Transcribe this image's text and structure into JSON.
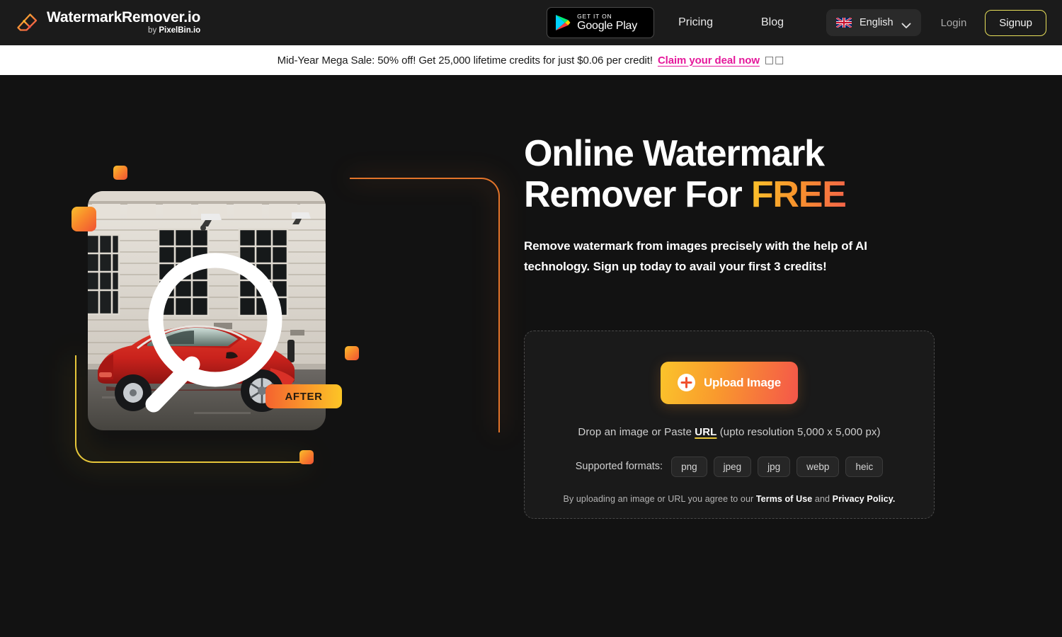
{
  "header": {
    "brand": {
      "name": "WatermarkRemover.io",
      "by_prefix": "by ",
      "by_name": "PixelBin.io"
    },
    "google_play": {
      "small": "GET IT ON",
      "big": "Google Play"
    },
    "nav": {
      "pricing": "Pricing",
      "blog": "Blog"
    },
    "language": {
      "label": "English",
      "flag": "uk-flag-icon"
    },
    "auth": {
      "login": "Login",
      "signup": "Signup"
    }
  },
  "promo": {
    "text": "Mid-Year Mega Sale: 50% off! Get 25,000 lifetime credits for just $0.06 per credit!",
    "cta": "Claim your deal now",
    "emoji": "□□"
  },
  "hero": {
    "headline_part1": "Online Watermark",
    "headline_part2": "Remover For ",
    "headline_highlight": "FREE",
    "subheadline": "Remove watermark from images precisely with the help of AI technology. Sign up today to avail your first 3 credits!",
    "image_badge": "AFTER"
  },
  "upload": {
    "button_label": "Upload Image",
    "drop_prefix": "Drop an image or Paste ",
    "drop_link": "URL",
    "drop_suffix": " (upto resolution 5,000 x 5,000 px)",
    "formats_label": "Supported formats:",
    "formats": [
      "png",
      "jpeg",
      "jpg",
      "webp",
      "heic"
    ],
    "terms_prefix": "By uploading an image or URL you agree to our ",
    "terms_link": "Terms of Use",
    "terms_and": " and ",
    "privacy_link": "Privacy Policy."
  },
  "colors": {
    "page_bg": "#121212",
    "header_bg": "#1b1b1b",
    "promo_bg": "#ffffff",
    "promo_accent": "#e5189b",
    "gradient_start": "#fbc42b",
    "gradient_end": "#f4564a",
    "signup_border": "#e8e05a",
    "url_underline": "#e7c63a"
  }
}
